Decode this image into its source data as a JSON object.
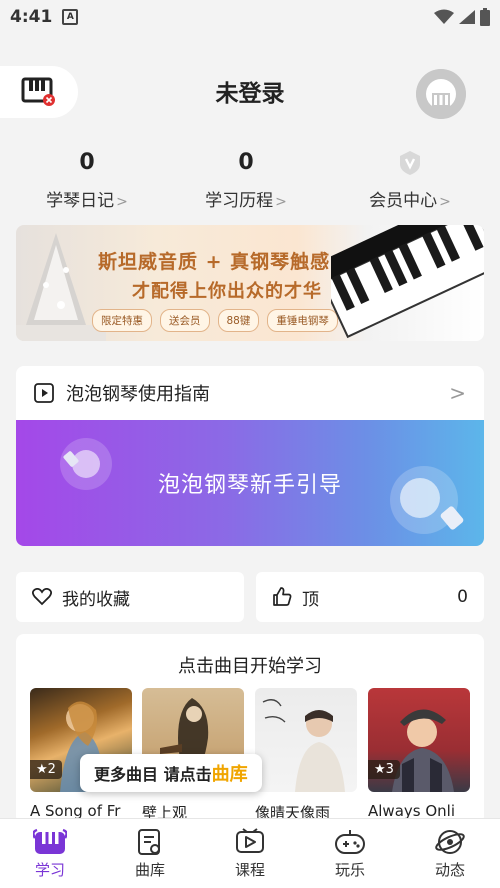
{
  "status_bar": {
    "time": "4:41",
    "indicator": "A"
  },
  "header": {
    "title": "未登录"
  },
  "stats": [
    {
      "value": "0",
      "label": "学琴日记",
      "chevron": ">"
    },
    {
      "value": "0",
      "label": "学习历程",
      "chevron": ">"
    },
    {
      "value": "",
      "label": "会员中心",
      "chevron": ">"
    }
  ],
  "banner": {
    "line1": "斯坦威音质 + 真钢琴触感",
    "line2": "才配得上你出众的才华",
    "tags": [
      "限定特惠",
      "送会员",
      "88键",
      "重锤电钢琴"
    ],
    "arrow": ">"
  },
  "guide": {
    "title": "泡泡钢琴使用指南",
    "chevron": ">",
    "banner_text": "泡泡钢琴新手引导"
  },
  "favorites": {
    "label": "我的收藏"
  },
  "top": {
    "label": "顶",
    "count": "0"
  },
  "songs": {
    "title": "点击曲目开始学习",
    "items": [
      {
        "name": "A Song of Fr",
        "stars": "★2"
      },
      {
        "name": "壁上观",
        "stars": ""
      },
      {
        "name": "像晴天像雨",
        "stars": ""
      },
      {
        "name": "Always Onli",
        "stars": "★3"
      }
    ],
    "tip_prefix": "更多曲目 请点击",
    "tip_highlight": "曲库"
  },
  "tabs": [
    {
      "label": "学习",
      "icon": "learn-icon",
      "active": true
    },
    {
      "label": "曲库",
      "icon": "library-icon",
      "active": false
    },
    {
      "label": "课程",
      "icon": "course-icon",
      "active": false
    },
    {
      "label": "玩乐",
      "icon": "game-icon",
      "active": false
    },
    {
      "label": "动态",
      "icon": "feed-icon",
      "active": false
    }
  ],
  "colors": {
    "accent": "#7a35d6",
    "banner_text": "#b76a2a",
    "tip_highlight": "#f0a500"
  }
}
